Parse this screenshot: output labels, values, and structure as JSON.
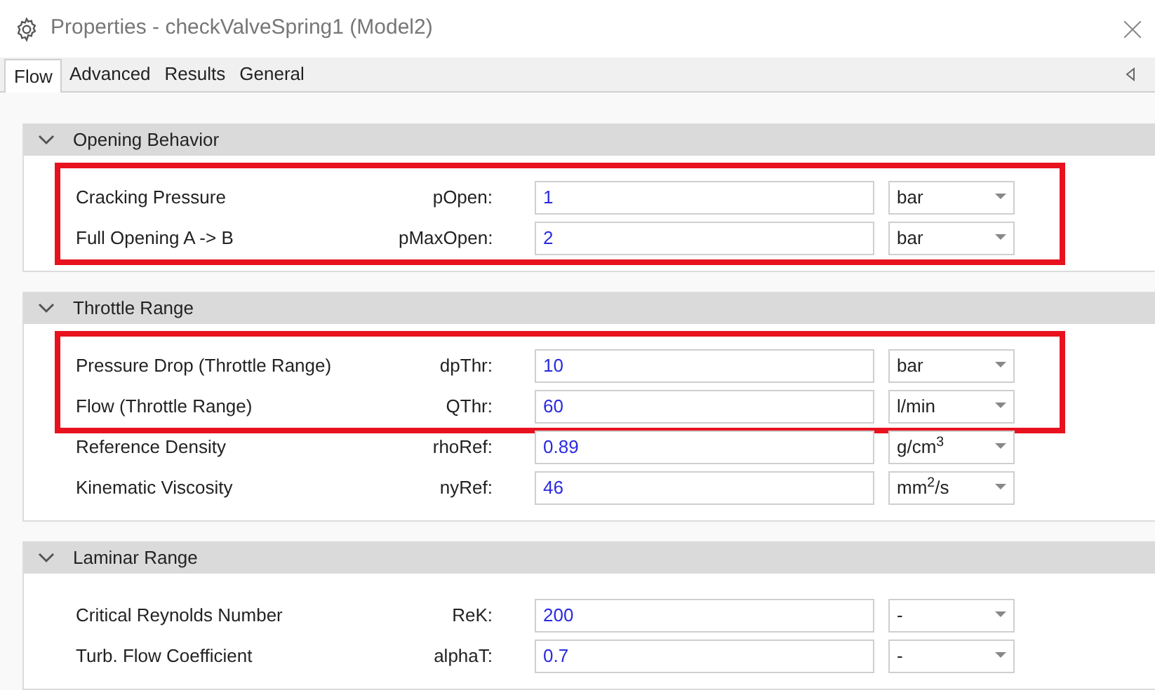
{
  "window": {
    "title": "Properties - checkValveSpring1 (Model2)"
  },
  "tabs": [
    {
      "label": "Flow",
      "selected": true
    },
    {
      "label": "Advanced",
      "selected": false
    },
    {
      "label": "Results",
      "selected": false
    },
    {
      "label": "General",
      "selected": false
    }
  ],
  "sections": [
    {
      "title": "Opening Behavior",
      "expanded": true,
      "rows": [
        {
          "label": "Cracking Pressure",
          "symbol": "pOpen:",
          "value": "1",
          "unit": "bar",
          "highlighted": true
        },
        {
          "label": "Full Opening A -> B",
          "symbol": "pMaxOpen:",
          "value": "2",
          "unit": "bar",
          "highlighted": true
        }
      ]
    },
    {
      "title": "Throttle Range",
      "expanded": true,
      "rows": [
        {
          "label": "Pressure Drop (Throttle Range)",
          "symbol": "dpThr:",
          "value": "10",
          "unit": "bar",
          "highlighted": true
        },
        {
          "label": "Flow (Throttle Range)",
          "symbol": "QThr:",
          "value": "60",
          "unit": "l/min",
          "highlighted": true
        },
        {
          "label": "Reference Density",
          "symbol": "rhoRef:",
          "value": "0.89",
          "unit": "g/cm$^{3}$",
          "highlighted": false
        },
        {
          "label": "Kinematic Viscosity",
          "symbol": "nyRef:",
          "value": "46",
          "unit": "mm$^{2}$/s",
          "highlighted": false
        }
      ]
    },
    {
      "title": "Laminar Range",
      "expanded": true,
      "rows": [
        {
          "label": "Critical Reynolds Number",
          "symbol": "ReK:",
          "value": "200",
          "unit": "-",
          "highlighted": false
        },
        {
          "label": "Turb. Flow Coefficient",
          "symbol": "alphaT:",
          "value": "0.7",
          "unit": "-",
          "highlighted": false
        }
      ]
    }
  ]
}
